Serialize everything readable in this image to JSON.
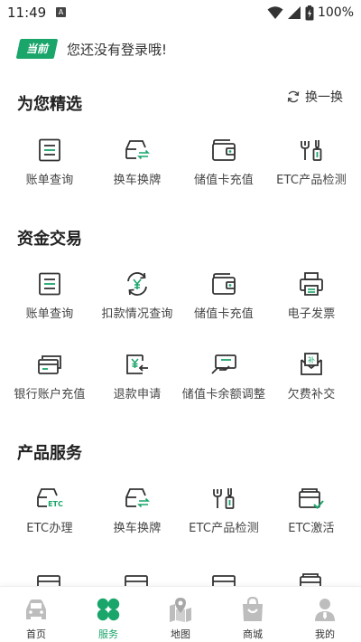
{
  "status_bar": {
    "time": "11:49",
    "notification_icon": "A",
    "battery_text": "100%"
  },
  "login": {
    "badge": "当前",
    "message": "您还没有登录哦!"
  },
  "colors": {
    "accent": "#1aa56b",
    "icon_dark": "#333333"
  },
  "featured": {
    "title": "为您精选",
    "shuffle_label": "换一换",
    "items": [
      {
        "label": "账单查询",
        "icon": "bill-icon"
      },
      {
        "label": "换车换牌",
        "icon": "car-swap-icon"
      },
      {
        "label": "储值卡充值",
        "icon": "wallet-icon"
      },
      {
        "label": "ETC产品检测",
        "icon": "tools-icon"
      }
    ]
  },
  "funds": {
    "title": "资金交易",
    "items": [
      {
        "label": "账单查询",
        "icon": "bill-icon"
      },
      {
        "label": "扣款情况查询",
        "icon": "deduction-icon"
      },
      {
        "label": "储值卡充值",
        "icon": "wallet-icon"
      },
      {
        "label": "电子发票",
        "icon": "printer-icon"
      },
      {
        "label": "银行账户充值",
        "icon": "bank-card-icon"
      },
      {
        "label": "退款申请",
        "icon": "refund-icon"
      },
      {
        "label": "储值卡余额调整",
        "icon": "balance-adjust-icon"
      },
      {
        "label": "欠费补交",
        "icon": "arrears-icon"
      }
    ]
  },
  "products": {
    "title": "产品服务",
    "items": [
      {
        "label": "ETC办理",
        "icon": "etc-car-icon"
      },
      {
        "label": "换车换牌",
        "icon": "car-swap-icon"
      },
      {
        "label": "ETC产品检测",
        "icon": "tools-icon"
      },
      {
        "label": "ETC激活",
        "icon": "etc-activate-icon"
      }
    ]
  },
  "bottom_nav": [
    {
      "label": "首页",
      "icon": "home-icon",
      "active": false
    },
    {
      "label": "服务",
      "icon": "services-icon",
      "active": true
    },
    {
      "label": "地图",
      "icon": "map-icon",
      "active": false
    },
    {
      "label": "商城",
      "icon": "shop-icon",
      "active": false
    },
    {
      "label": "我的",
      "icon": "profile-icon",
      "active": false
    }
  ]
}
